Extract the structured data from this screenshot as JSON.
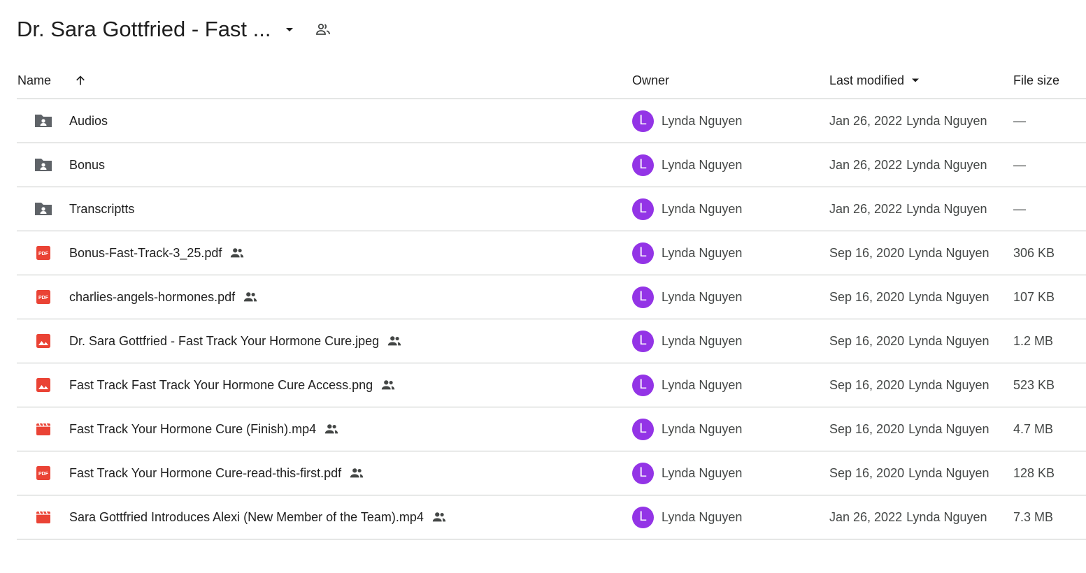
{
  "title": {
    "text": "Dr. Sara Gottfried - Fast ..."
  },
  "columns": {
    "name": "Name",
    "owner": "Owner",
    "modified": "Last modified",
    "size": "File size"
  },
  "colors": {
    "avatar": "#9334e6",
    "folder_icon": "#5f6368",
    "file_icon": "#ea4335"
  },
  "files": [
    {
      "icon": "shared-folder-icon",
      "name": "Audios",
      "shared": false,
      "owner_initial": "L",
      "owner": "Lynda Nguyen",
      "modified_date": "Jan 26, 2022",
      "modified_by": "Lynda Nguyen",
      "size": "—"
    },
    {
      "icon": "shared-folder-icon",
      "name": "Bonus",
      "shared": false,
      "owner_initial": "L",
      "owner": "Lynda Nguyen",
      "modified_date": "Jan 26, 2022",
      "modified_by": "Lynda Nguyen",
      "size": "—"
    },
    {
      "icon": "shared-folder-icon",
      "name": "Transcriptts",
      "shared": false,
      "owner_initial": "L",
      "owner": "Lynda Nguyen",
      "modified_date": "Jan 26, 2022",
      "modified_by": "Lynda Nguyen",
      "size": "—"
    },
    {
      "icon": "pdf-icon",
      "name": "Bonus-Fast-Track-3_25.pdf",
      "shared": true,
      "owner_initial": "L",
      "owner": "Lynda Nguyen",
      "modified_date": "Sep 16, 2020",
      "modified_by": "Lynda Nguyen",
      "size": "306 KB"
    },
    {
      "icon": "pdf-icon",
      "name": "charlies-angels-hormones.pdf",
      "shared": true,
      "owner_initial": "L",
      "owner": "Lynda Nguyen",
      "modified_date": "Sep 16, 2020",
      "modified_by": "Lynda Nguyen",
      "size": "107 KB"
    },
    {
      "icon": "image-icon",
      "name": "Dr. Sara Gottfried - Fast Track Your Hormone Cure.jpeg",
      "shared": true,
      "owner_initial": "L",
      "owner": "Lynda Nguyen",
      "modified_date": "Sep 16, 2020",
      "modified_by": "Lynda Nguyen",
      "size": "1.2 MB"
    },
    {
      "icon": "image-icon",
      "name": "Fast Track Fast Track Your Hormone Cure Access.png",
      "shared": true,
      "owner_initial": "L",
      "owner": "Lynda Nguyen",
      "modified_date": "Sep 16, 2020",
      "modified_by": "Lynda Nguyen",
      "size": "523 KB"
    },
    {
      "icon": "video-icon",
      "name": "Fast Track Your Hormone Cure (Finish).mp4",
      "shared": true,
      "owner_initial": "L",
      "owner": "Lynda Nguyen",
      "modified_date": "Sep 16, 2020",
      "modified_by": "Lynda Nguyen",
      "size": "4.7 MB"
    },
    {
      "icon": "pdf-icon",
      "name": "Fast Track Your Hormone Cure-read-this-first.pdf",
      "shared": true,
      "owner_initial": "L",
      "owner": "Lynda Nguyen",
      "modified_date": "Sep 16, 2020",
      "modified_by": "Lynda Nguyen",
      "size": "128 KB"
    },
    {
      "icon": "video-icon",
      "name": "Sara Gottfried Introduces Alexi (New Member of the Team).mp4",
      "shared": true,
      "owner_initial": "L",
      "owner": "Lynda Nguyen",
      "modified_date": "Jan 26, 2022",
      "modified_by": "Lynda Nguyen",
      "size": "7.3 MB"
    }
  ]
}
